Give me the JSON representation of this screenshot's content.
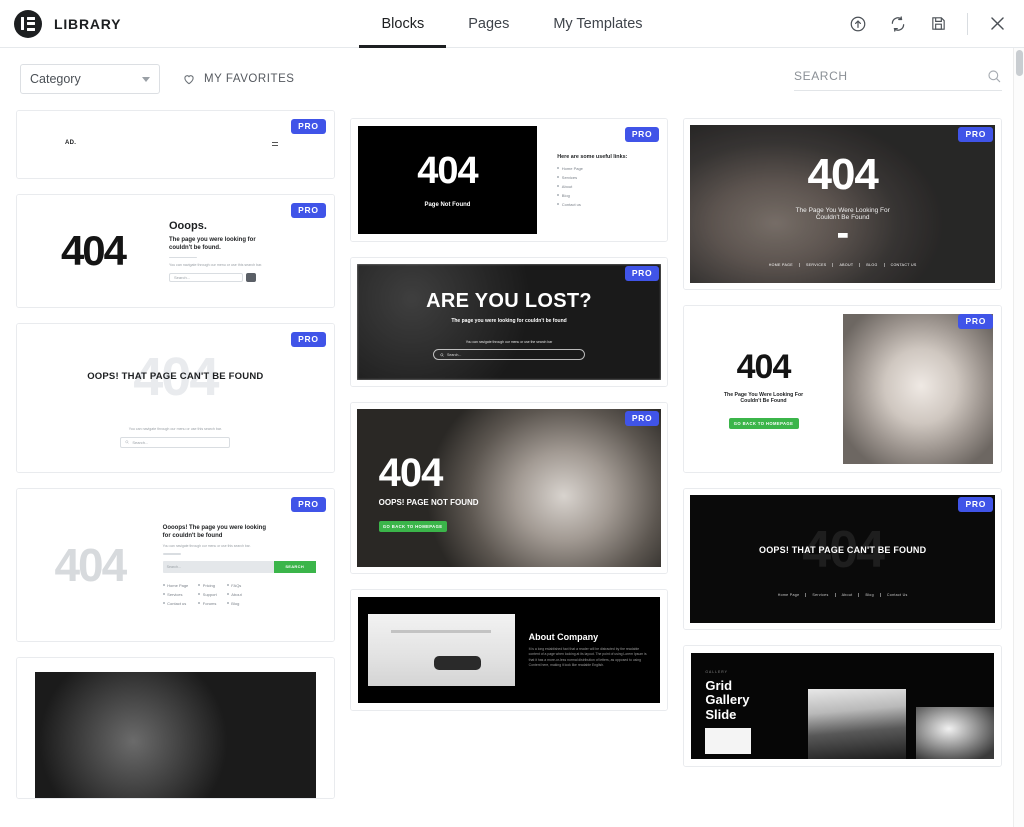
{
  "header": {
    "brand_title": "LIBRARY",
    "logo_icon": "elementor-logo-icon",
    "tabs": [
      {
        "label": "Blocks",
        "active": true
      },
      {
        "label": "Pages",
        "active": false
      },
      {
        "label": "My Templates",
        "active": false
      }
    ],
    "actions": [
      {
        "name": "import-template-button",
        "icon": "upload-circle-icon"
      },
      {
        "name": "sync-library-button",
        "icon": "sync-icon"
      },
      {
        "name": "save-template-button",
        "icon": "floppy-disk-icon"
      },
      {
        "name": "close-modal-button",
        "icon": "close-icon"
      }
    ]
  },
  "toolbar": {
    "category_label": "Category",
    "category_options": [
      "Category"
    ],
    "favorites_label": "MY FAVORITES",
    "favorites_icon": "heart-icon",
    "search_placeholder": "SEARCH",
    "search_value": "",
    "search_icon": "search-icon"
  },
  "badge": {
    "pro_label": "PRO",
    "pro_color": "#4054e8"
  },
  "colors": {
    "accent": "#4054e8",
    "green_button": "#3bb54a",
    "dark": "#1d1f21"
  },
  "columns": [
    {
      "cards": [
        {
          "name": "template-card-ad-header",
          "pro": true,
          "type": "ad-header",
          "logo_text": "AD.",
          "menu_icon": "hamburger-icon"
        },
        {
          "name": "template-card-404-ooops",
          "pro": true,
          "type": "404-split-light",
          "code": "404",
          "heading": "Ooops.",
          "subheading": "The page you were looking for couldn't be found.",
          "body": "You can navigate through our menu or use this search bar.",
          "search_placeholder": "Search...",
          "search_icon": "search-icon"
        },
        {
          "name": "template-card-404-oops-light",
          "pro": true,
          "type": "404-ghost-light",
          "code": "404",
          "heading": "OOPS! THAT PAGE CAN'T BE FOUND",
          "body": "You can navigate through our menu or use this search bar.",
          "search_placeholder": "Search...",
          "search_icon": "search-icon"
        },
        {
          "name": "template-card-404-oooops-links",
          "pro": true,
          "type": "404-links-light",
          "code": "404",
          "heading": "Oooops! The page you were looking for couldn't be found",
          "body": "You can navigate through our menu or use this search bar.",
          "search_placeholder": "Search...",
          "search_button": "SEARCH",
          "links": [
            [
              "Home Page",
              "Services",
              "Contact us"
            ],
            [
              "Pricing",
              "Support",
              "Forums"
            ],
            [
              "FAQs",
              "About",
              "Blog"
            ]
          ]
        },
        {
          "name": "template-card-dark-city",
          "pro": false,
          "type": "photo-dark-city"
        }
      ]
    },
    {
      "cards": [
        {
          "name": "template-card-404-page-not-found",
          "pro": true,
          "type": "404-black-links",
          "code": "404",
          "caption": "Page Not Found",
          "links_title": "Here are some useful links:",
          "links": [
            "Home Page",
            "Services",
            "About",
            "Blog",
            "Contact us"
          ]
        },
        {
          "name": "template-card-are-you-lost",
          "pro": true,
          "type": "404-photo-crowd",
          "heading": "ARE YOU LOST?",
          "subheading": "The page you were looking for couldn't be found",
          "body": "You can navigate through our menu or use the search bar",
          "search_placeholder": "Search...",
          "search_icon": "search-icon"
        },
        {
          "name": "template-card-404-oops-page-not-found",
          "pro": true,
          "type": "404-photo-man",
          "code": "404",
          "subheading": "OOPS! PAGE NOT FOUND",
          "button": "GO BACK TO HOMEPAGE"
        },
        {
          "name": "template-card-about-company",
          "pro": false,
          "type": "about-company",
          "heading": "About Company",
          "body": "It is a long established fact that a reader will be distracted by the readable content of a page when looking at its layout. The point of using Lorem Ipsum is that it has a more-or-less normal distribution of letters, as opposed to using Content here, making it look like readable English."
        }
      ]
    },
    {
      "cards": [
        {
          "name": "template-card-404-hands-photo",
          "pro": true,
          "type": "404-photo-hands",
          "code": "404",
          "subheading_line1": "The Page You Were Looking For",
          "subheading_line2": "Couldn't Be Found",
          "nav": [
            "HOME PAGE",
            "SERVICES",
            "ABOUT",
            "BLOG",
            "CONTACT US"
          ]
        },
        {
          "name": "template-card-404-baby-photo",
          "pro": true,
          "type": "404-baby",
          "code": "404",
          "subheading_line1": "The Page You Were Looking For",
          "subheading_line2": "Couldn't Be Found",
          "button": "GO BACK TO HOMEPAGE"
        },
        {
          "name": "template-card-404-oops-dark",
          "pro": true,
          "type": "404-ghost-dark",
          "code": "404",
          "heading": "OOPS! THAT PAGE CAN'T BE FOUND",
          "nav": [
            "Home Page",
            "Services",
            "About",
            "Blog",
            "Contact Us"
          ]
        },
        {
          "name": "template-card-grid-gallery-slide",
          "pro": false,
          "type": "grid-gallery",
          "eyebrow": "GALLERY",
          "heading_lines": [
            "Grid",
            "Gallery",
            "Slide"
          ]
        }
      ]
    }
  ]
}
